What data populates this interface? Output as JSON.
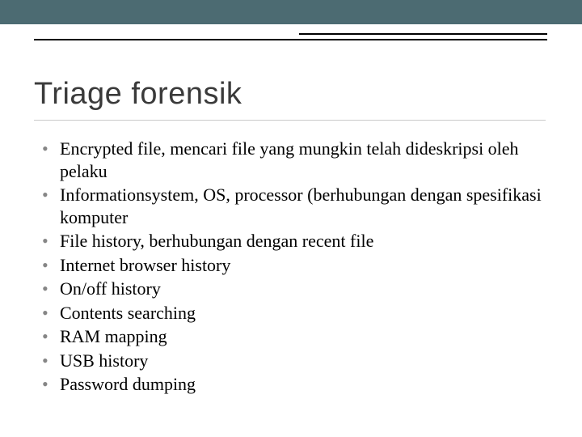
{
  "slide": {
    "title": "Triage forensik",
    "bullets": [
      "Encrypted file, mencari file yang mungkin telah dideskripsi oleh pelaku",
      "Informationsystem, OS, processor (berhubungan dengan spesifikasi komputer",
      "File history, berhubungan dengan recent file",
      "Internet browser history",
      "On/off history",
      "Contents searching",
      "RAM mapping",
      "USB history",
      "Password dumping"
    ]
  }
}
